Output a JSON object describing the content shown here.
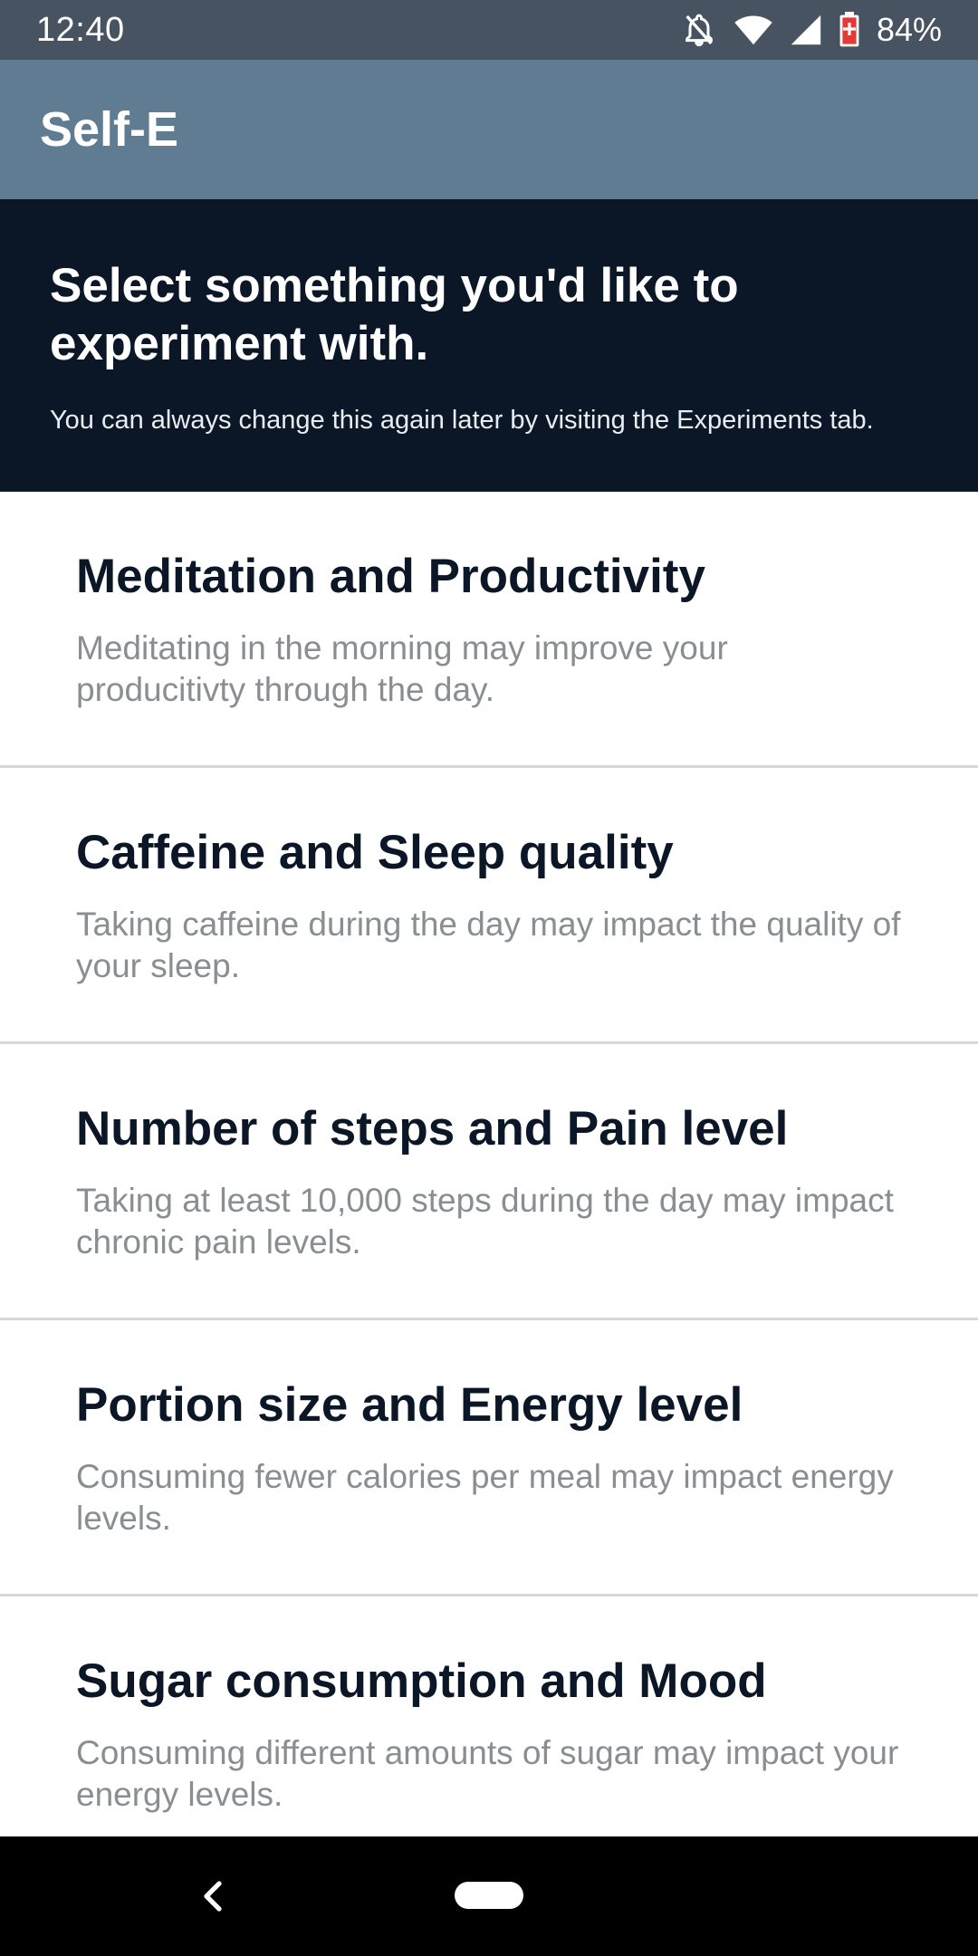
{
  "status_bar": {
    "time": "12:40",
    "battery_percent": "84%",
    "icons": [
      "notifications-off-icon",
      "wifi-icon",
      "signal-icon",
      "battery-icon"
    ]
  },
  "app_bar": {
    "title": "Self-E"
  },
  "intro": {
    "title": "Select something you'd like to experiment with.",
    "subtitle": "You can always change this again later by visiting the Experiments tab."
  },
  "experiments": [
    {
      "title": "Meditation and Productivity",
      "description": "Meditating in the morning may improve your producitivty through the day."
    },
    {
      "title": "Caffeine and Sleep quality",
      "description": "Taking caffeine during the day may impact the quality of your sleep."
    },
    {
      "title": "Number of steps and Pain level",
      "description": "Taking at least 10,000 steps during the day may impact chronic pain levels."
    },
    {
      "title": "Portion size and Energy level",
      "description": "Consuming fewer calories per meal may impact energy levels."
    },
    {
      "title": "Sugar consumption and Mood",
      "description": "Consuming different amounts of sugar may impact your energy levels."
    }
  ],
  "nav_bar": {
    "icons": [
      "back-icon",
      "home-icon"
    ]
  },
  "colors": {
    "status_bar": "#475361",
    "app_bar": "#5f7c92",
    "intro_bg": "#0b1727",
    "title_text": "#0b1727",
    "desc_text": "#8a8e92",
    "divider": "#d5d8db"
  }
}
